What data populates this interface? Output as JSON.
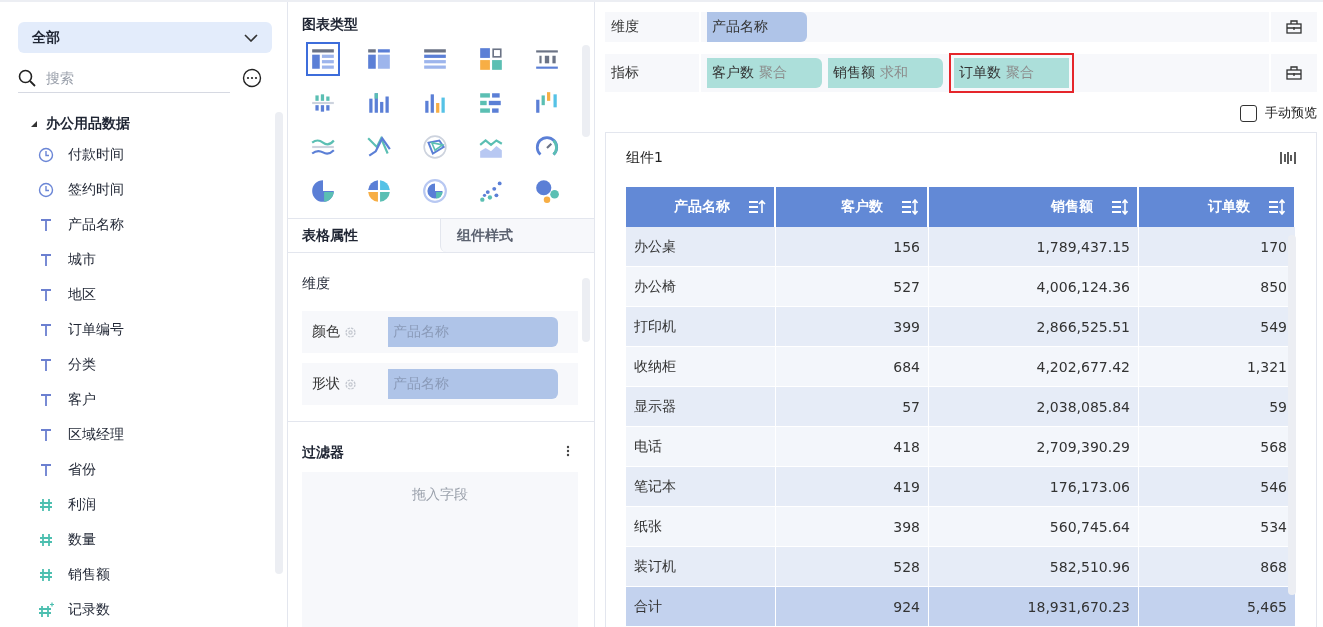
{
  "field_panel": {
    "scope": "全部",
    "search": {
      "placeholder": "搜索"
    },
    "tree": [
      {
        "label": "办公用品数据",
        "expanded": true,
        "children": [
          {
            "label": "付款时间",
            "kind": "time"
          },
          {
            "label": "签约时间",
            "kind": "time"
          },
          {
            "label": "产品名称",
            "kind": "text"
          },
          {
            "label": "城市",
            "kind": "text"
          },
          {
            "label": "地区",
            "kind": "text"
          },
          {
            "label": "订单编号",
            "kind": "text"
          },
          {
            "label": "分类",
            "kind": "text"
          },
          {
            "label": "客户",
            "kind": "text"
          },
          {
            "label": "区域经理",
            "kind": "text"
          },
          {
            "label": "省份",
            "kind": "text"
          },
          {
            "label": "利润",
            "kind": "number"
          },
          {
            "label": "数量",
            "kind": "number"
          },
          {
            "label": "销售额",
            "kind": "number"
          },
          {
            "label": "记录数",
            "kind": "record"
          }
        ]
      }
    ]
  },
  "config_panel": {
    "chart_type_title": "图表类型",
    "chart_types": [
      {
        "kind": "detail-table",
        "selected": true
      },
      {
        "kind": "group-table",
        "selected": false
      },
      {
        "kind": "cross-table",
        "selected": false
      },
      {
        "kind": "multi-block",
        "selected": false
      },
      {
        "kind": "kpi",
        "selected": false
      },
      {
        "kind": "bar-grouped",
        "selected": false
      },
      {
        "kind": "bar-stacked",
        "selected": false
      },
      {
        "kind": "bar",
        "selected": false
      },
      {
        "kind": "bar-horizontal",
        "selected": false
      },
      {
        "kind": "bar-range",
        "selected": false
      },
      {
        "kind": "line",
        "selected": false
      },
      {
        "kind": "line-cross",
        "selected": false
      },
      {
        "kind": "radar",
        "selected": false
      },
      {
        "kind": "area",
        "selected": false
      },
      {
        "kind": "gauge",
        "selected": false
      },
      {
        "kind": "pie",
        "selected": false
      },
      {
        "kind": "pie-multi",
        "selected": false
      },
      {
        "kind": "donut",
        "selected": false
      },
      {
        "kind": "scatter",
        "selected": false
      },
      {
        "kind": "bubble",
        "selected": false
      }
    ],
    "tabs": [
      {
        "label": "表格属性",
        "selected": true
      },
      {
        "label": "组件样式",
        "selected": false
      }
    ],
    "section_title": "维度",
    "properties": [
      {
        "label": "颜色",
        "value": "产品名称"
      },
      {
        "label": "形状",
        "value": "产品名称"
      }
    ],
    "filter": {
      "title": "过滤器",
      "drop_hint": "拖入字段"
    }
  },
  "editor": {
    "shelves": [
      {
        "label": "维度",
        "chips": [
          {
            "name": "产品名称",
            "kind": "dimension",
            "highlighted": false
          }
        ]
      },
      {
        "label": "指标",
        "chips": [
          {
            "name": "客户数",
            "aggregation": "聚合",
            "kind": "measure",
            "highlighted": false
          },
          {
            "name": "销售额",
            "aggregation": "求和",
            "kind": "measure",
            "highlighted": false
          },
          {
            "name": "订单数",
            "aggregation": "聚合",
            "kind": "measure",
            "highlighted": true
          }
        ]
      }
    ],
    "manual_preview": {
      "label": "手动预览",
      "checked": false
    },
    "widget": {
      "title": "组件1",
      "table": {
        "columns": [
          "产品名称",
          "客户数",
          "销售额",
          "订单数"
        ],
        "rows": [
          [
            "办公桌",
            "156",
            "1,789,437.15",
            "170"
          ],
          [
            "办公椅",
            "527",
            "4,006,124.36",
            "850"
          ],
          [
            "打印机",
            "399",
            "2,866,525.51",
            "549"
          ],
          [
            "收纳柜",
            "684",
            "4,202,677.42",
            "1,321"
          ],
          [
            "显示器",
            "57",
            "2,038,085.84",
            "59"
          ],
          [
            "电话",
            "418",
            "2,709,390.29",
            "568"
          ],
          [
            "笔记本",
            "419",
            "176,173.06",
            "546"
          ],
          [
            "纸张",
            "398",
            "560,745.64",
            "534"
          ],
          [
            "装订机",
            "528",
            "582,510.96",
            "868"
          ]
        ],
        "total": [
          "合计",
          "924",
          "18,931,670.23",
          "5,465"
        ]
      }
    }
  }
}
